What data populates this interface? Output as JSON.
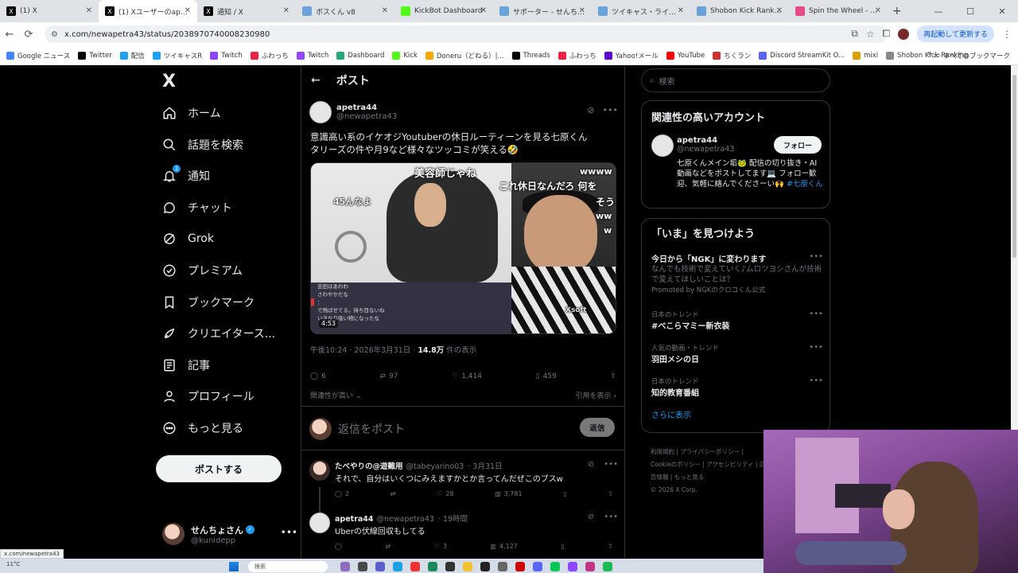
{
  "browser": {
    "tabs": [
      {
        "label": "(1) X",
        "icon": "x-icon",
        "active": false
      },
      {
        "label": "(1) Xユーザーのapetra4",
        "icon": "x-icon",
        "active": true
      },
      {
        "label": "通知 / X",
        "icon": "x-icon",
        "active": false
      },
      {
        "label": "ボスくん v8",
        "icon": "globe-icon",
        "active": false
      },
      {
        "label": "KickBot Dashboard",
        "icon": "kick-icon",
        "active": false
      },
      {
        "label": "サポーター - せんちょさん",
        "icon": "twitcasting-icon",
        "active": false
      },
      {
        "label": "ツイキャス・ライブでつな",
        "icon": "twitcasting-icon",
        "active": false
      },
      {
        "label": "Shobon Kick Ranking",
        "icon": "shobon-icon",
        "active": false
      },
      {
        "label": "Spin the Wheel - Fre",
        "icon": "wheel-icon",
        "active": false
      }
    ],
    "url": "x.com/newapetra43/status/2038970740008230980",
    "relaunch_label": "再起動して更新する",
    "bookmarks": [
      {
        "label": "Google ニュース",
        "icon": "google-news-icon",
        "color": "#4285f4"
      },
      {
        "label": "Twitter",
        "icon": "x-icon",
        "color": "#000000"
      },
      {
        "label": "配信",
        "icon": "twitcasting-icon",
        "color": "#1da1f2"
      },
      {
        "label": "ツイキャスR",
        "icon": "twitcasting-icon",
        "color": "#1da1f2"
      },
      {
        "label": "Twitch",
        "icon": "twitch-icon",
        "color": "#9146ff"
      },
      {
        "label": "ふわっち",
        "icon": "fuwatch-icon",
        "color": "#e24"
      },
      {
        "label": "Twitch",
        "icon": "twitch-icon",
        "color": "#9146ff"
      },
      {
        "label": "Dashboard",
        "icon": "dashboard-icon",
        "color": "#2a7"
      },
      {
        "label": "Kick",
        "icon": "kick-icon",
        "color": "#53fc18"
      },
      {
        "label": "Doneru（どねる）|...",
        "icon": "doneru-icon",
        "color": "#f6a800"
      },
      {
        "label": "Threads",
        "icon": "threads-icon",
        "color": "#000000"
      },
      {
        "label": "ふわっち",
        "icon": "fuwatch-icon",
        "color": "#e24"
      },
      {
        "label": "Yahoo!メール",
        "icon": "yahoo-mail-icon",
        "color": "#6001d2"
      },
      {
        "label": "YouTube",
        "icon": "youtube-icon",
        "color": "#ff0000"
      },
      {
        "label": "ちくラン",
        "icon": "chikuran-icon",
        "color": "#c33"
      },
      {
        "label": "Discord StreamKit O...",
        "icon": "discord-icon",
        "color": "#5865f2"
      },
      {
        "label": "mixi",
        "icon": "mixi-icon",
        "color": "#d8a000"
      },
      {
        "label": "Shobon Kick Ranking",
        "icon": "shobon-icon",
        "color": "#888888"
      }
    ],
    "all_bookmarks_label": "すべてのブックマーク",
    "status_url": "x.com/newapetra43"
  },
  "nav": {
    "logo": "X",
    "items": [
      {
        "label": "ホーム",
        "icon": "home-icon"
      },
      {
        "label": "話題を検索",
        "icon": "search-icon"
      },
      {
        "label": "通知",
        "icon": "bell-icon",
        "badge": "1"
      },
      {
        "label": "チャット",
        "icon": "chat-icon"
      },
      {
        "label": "Grok",
        "icon": "grok-icon"
      },
      {
        "label": "プレミアム",
        "icon": "premium-icon"
      },
      {
        "label": "ブックマーク",
        "icon": "bookmark-icon"
      },
      {
        "label": "クリエイタース...",
        "icon": "rocket-icon"
      },
      {
        "label": "記事",
        "icon": "article-icon"
      },
      {
        "label": "プロフィール",
        "icon": "profile-icon"
      },
      {
        "label": "もっと見る",
        "icon": "more-circle-icon"
      }
    ],
    "post_button": "ポストする",
    "user": {
      "name": "せんちょさん",
      "handle": "@kunidepp"
    }
  },
  "main": {
    "title": "ポスト",
    "post": {
      "name": "apetra44",
      "handle": "@newapetra43",
      "text_line1": "意識高い系のイケオジYoutuberの休日ルーティーンを見る七原くん",
      "text_line2": "タリーズの件や月9など様々なツッコミが笑える🤣",
      "media": {
        "caption_top": "美容師じゃね",
        "caption_left": "45んなよ",
        "caption_right": "これ休日なんだろ 何を",
        "caption_right2": "そう",
        "caption_www": "wwww",
        "caption_ww": "ww",
        "caption_w": "w",
        "watermark": "Xsoft",
        "video_time": "4:53",
        "chat_lines": [
          "吉田はあわわ",
          "さわやかだな",
          "：",
          "で飛ばせてる。持ち目ないね",
          "いきなり吸い物になったな"
        ]
      },
      "time": "午後10:24 · 2026年3月31日 · ",
      "views": "14.8万",
      "views_suffix": " 件の表示",
      "replies": "6",
      "reposts": "97",
      "likes": "1,414",
      "bookmarks": "459",
      "sort_label": "関連性が高い",
      "quotes_label": "引用を表示"
    },
    "reply_placeholder": "返信をポスト",
    "reply_button": "返信",
    "replies": [
      {
        "name": "たべやりの@遊難用",
        "handle": "@tabeyarino03",
        "time": "· 3月31日",
        "text": "それで、自分はいくつにみえますかとか言ってんだぜこのブスw",
        "replies": "2",
        "reposts": "",
        "likes": "28",
        "views": "3,781"
      },
      {
        "name": "apetra44",
        "handle": "@newapetra43",
        "time": "· 19時間",
        "text": "Uberの伏線回収もしてる",
        "replies": "",
        "reposts": "",
        "likes": "3",
        "views": "4,127"
      }
    ]
  },
  "right": {
    "search_placeholder": "検索",
    "related_title": "関連性の高いアカウント",
    "related": {
      "name": "apetra44",
      "handle": "@newapetra43",
      "follow": "フォロー",
      "bio": "七原くんメイン垢🐸 配信の切り抜き・AI動画などをポストしてます💻 フォロー歓迎、気軽に絡んでくださーい🙌 ",
      "bio_tag": "#七原くん"
    },
    "trends_title": "「いま」を見つけよう",
    "trends": [
      {
        "context": "",
        "title": "今日から「NGK」に変わります",
        "desc": "なんでも技術で変えていく♪ムロツヨシさんが技術で変えてほしいことは？",
        "promo": "Promoted by NGKのクロコくん公式"
      },
      {
        "context": "日本のトレンド",
        "title": "#べこらマミー新衣装",
        "desc": "",
        "promo": ""
      },
      {
        "context": "人気の動画・トレンド",
        "title": "羽田メシの日",
        "desc": "",
        "promo": ""
      },
      {
        "context": "日本のトレンド",
        "title": "知的教育番組",
        "desc": "",
        "promo": ""
      }
    ],
    "show_more": "さらに表示",
    "footer": [
      "利用規約",
      "プライバシーポリシー",
      "Cookieのポリシー",
      "アクセシビリティ",
      "広告情報",
      "もっと見る",
      "© 2026 X Corp."
    ]
  },
  "taskbar": {
    "weather": "11°C",
    "search": "検索"
  }
}
